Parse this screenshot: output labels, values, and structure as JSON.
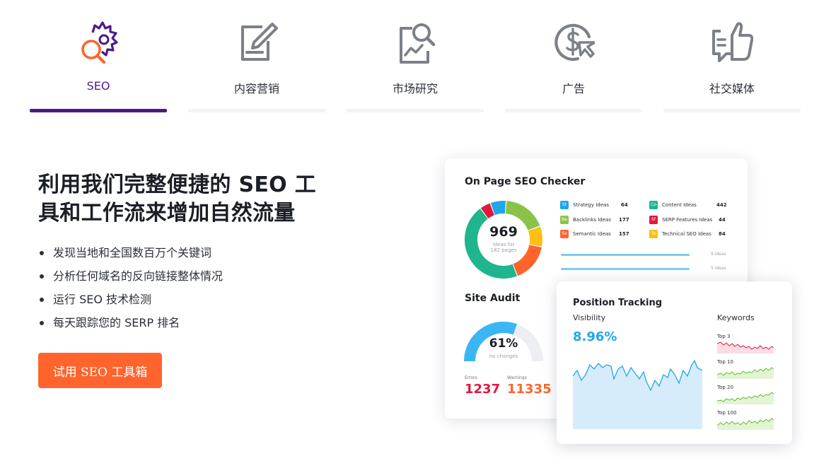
{
  "tabs": [
    {
      "label": "SEO",
      "icon": "seo-magnifier-gear-icon",
      "active": true
    },
    {
      "label": "内容营销",
      "icon": "edit-document-icon",
      "active": false
    },
    {
      "label": "市场研究",
      "icon": "market-research-icon",
      "active": false
    },
    {
      "label": "广告",
      "icon": "ad-dollar-cursor-icon",
      "active": false
    },
    {
      "label": "社交媒体",
      "icon": "social-thumbs-up-icon",
      "active": false
    }
  ],
  "main": {
    "headline": "利用我们完整便捷的 SEO 工具和工作流来增加自然流量",
    "features": [
      "发现当地和全国数百万个关键词",
      "分析任何域名的反向链接整体情况",
      "运行 SEO 技术检测",
      "每天跟踪您的 SERP 排名"
    ],
    "cta_label": "试用 SEO 工具箱"
  },
  "dashboard": {
    "on_page": {
      "title": "On Page SEO Checker",
      "donut_value": "969",
      "donut_caption_1": "ideas for",
      "donut_caption_2": "182 pages",
      "legend": [
        {
          "abbr": "St",
          "name": "Strategy Ideas",
          "value": "64",
          "color": "#1fa7e8"
        },
        {
          "abbr": "Co",
          "name": "Content Ideas",
          "value": "442",
          "color": "#1fb58d"
        },
        {
          "abbr": "Ba",
          "name": "Backlinks Ideas",
          "value": "177",
          "color": "#8bc34a"
        },
        {
          "abbr": "Sf",
          "name": "SERP Features Ideas",
          "value": "44",
          "color": "#e3173e"
        },
        {
          "abbr": "Se",
          "name": "Semantic Ideas",
          "value": "157",
          "color": "#ff642d"
        },
        {
          "abbr": "Te",
          "name": "Technical SEO Ideas",
          "value": "84",
          "color": "#fcbf15"
        }
      ],
      "bars": [
        {
          "label": "9 Ideas",
          "fraction": 0.96
        },
        {
          "label": "5 Ideas",
          "fraction": 0.96
        }
      ]
    },
    "site_audit": {
      "title": "Site Audit",
      "percent": "61%",
      "percent_value": 61,
      "caption": "no changes",
      "errors_label": "Errors",
      "errors_value": "1237",
      "warnings_label": "Warnings",
      "warnings_value": "11335",
      "colors": {
        "errors": "#e3173e",
        "warnings": "#ff642d",
        "gauge": "#3bb6f5"
      }
    },
    "position_tracking": {
      "title": "Position Tracking",
      "visibility_label": "Visibility",
      "visibility_value": "8.96%",
      "keywords_label": "Keywords",
      "keywords": [
        {
          "label": "Top 3",
          "color": "#e3173e"
        },
        {
          "label": "Top 10",
          "color": "#5fbf2a"
        },
        {
          "label": "Top 20",
          "color": "#5fbf2a"
        },
        {
          "label": "Top 100",
          "color": "#5fbf2a"
        }
      ]
    }
  },
  "colors": {
    "brand": "#4b1b86",
    "accent": "#ff642d",
    "link": "#23a6e8"
  }
}
